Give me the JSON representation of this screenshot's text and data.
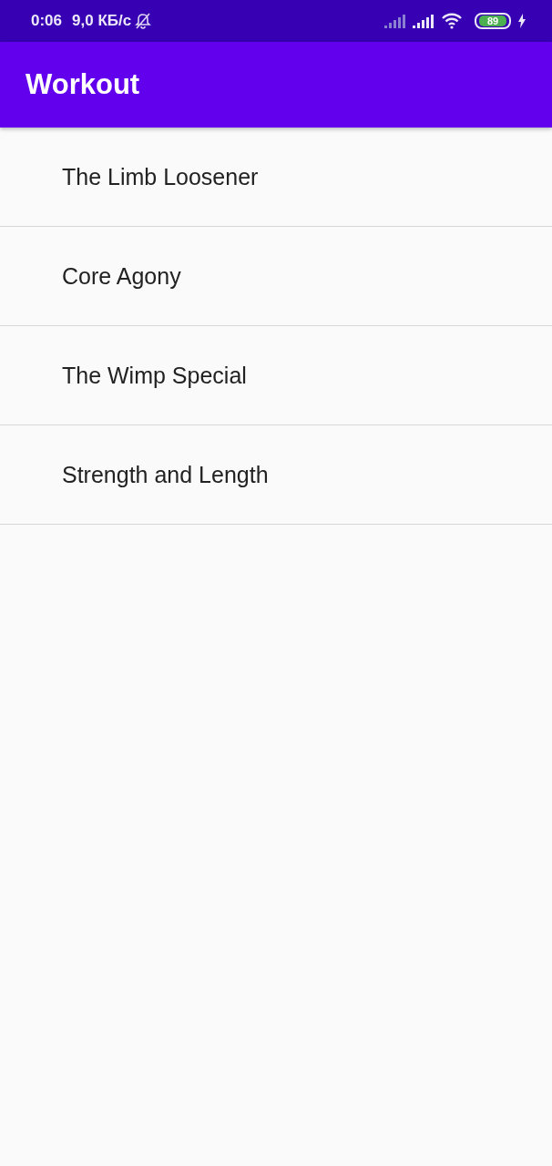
{
  "status_bar": {
    "time": "0:06",
    "speed": "9,0 КБ/с",
    "battery": "89"
  },
  "app_bar": {
    "title": "Workout"
  },
  "workouts": [
    {
      "name": "The Limb Loosener"
    },
    {
      "name": "Core Agony"
    },
    {
      "name": "The Wimp Special"
    },
    {
      "name": "Strength and Length"
    }
  ]
}
